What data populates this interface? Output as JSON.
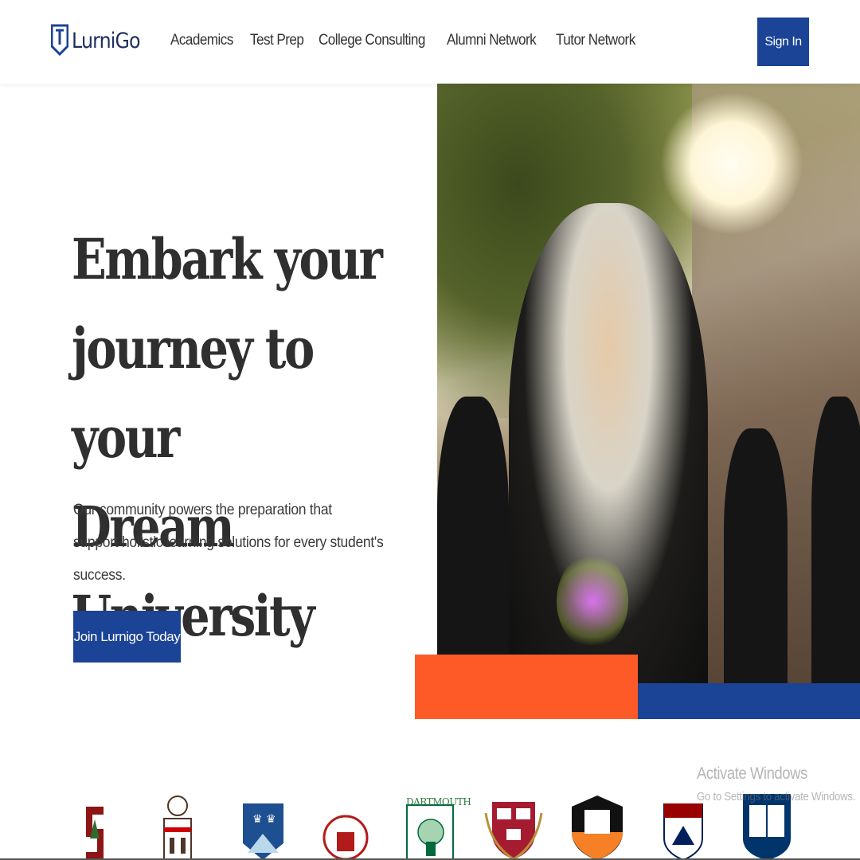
{
  "brand": {
    "name": "LurniGo",
    "color": "#1b4396"
  },
  "nav": {
    "items": [
      "Academics",
      "Test Prep",
      "College Consulting",
      "Alumni Network",
      "Tutor Network"
    ]
  },
  "header": {
    "signin_label": "Sign In"
  },
  "hero": {
    "title_lines": [
      "Embark your",
      "journey to your",
      "Dream University"
    ],
    "subtitle_lines": [
      "Our community powers the preparation that",
      "support holistic learning solutions for every student's success."
    ],
    "cta_label": "Join Lurnigo Today",
    "accent_orange": "#fd5a28",
    "accent_blue": "#1b4396"
  },
  "logos": {
    "universities": [
      "stanford-logo",
      "brown-logo",
      "columbia-logo",
      "cornell-logo",
      "dartmouth-logo",
      "harvard-logo",
      "princeton-logo",
      "penn-logo",
      "yale-logo"
    ],
    "dartmouth_text": "DARTMOUTH"
  },
  "watermark": {
    "title": "Activate Windows",
    "subtitle": "Go to Settings to activate Windows."
  }
}
